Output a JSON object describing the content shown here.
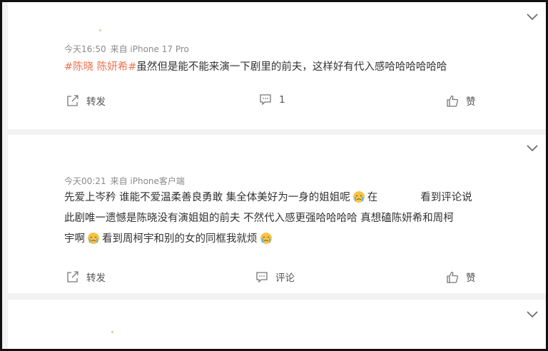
{
  "posts": [
    {
      "meta_time": "今天16:50",
      "meta_source": "来自 iPhone 17 Pro",
      "topic": "#陈晓 陈妍希#",
      "text": "虽然但是能不能来演一下剧里的前夫，这样好有代入感哈哈哈哈哈哈",
      "repost_label": "转发",
      "comment_label": "1",
      "like_label": "赞"
    },
    {
      "meta_time": "今天00:21",
      "meta_source": "来自 iPhone客户端",
      "text_line1_a": "先爱上岑矜 谁能不爱温柔善良勇敢 集全体美好为一身的姐姐呢",
      "text_line1_b": "在",
      "text_line1_c": "看到评论说",
      "text_line2": "此剧唯一遗憾是陈晓没有演姐姐的前夫 不然代入感更强哈哈哈哈 真想磕陈妍希和周柯",
      "text_line3_a": "宇啊",
      "text_line3_b": "看到周柯宇和别的女的同框我就烦",
      "repost_label": "转发",
      "comment_label": "评论",
      "like_label": "赞"
    }
  ],
  "colors": {
    "topic": "#eb7350",
    "meta": "#8a8a8a",
    "text": "#333333",
    "separator": "#f2f2f2"
  },
  "icons": [
    "chevron-down-icon",
    "repost-icon",
    "comment-icon",
    "like-icon",
    "crying-emoji-icon"
  ]
}
